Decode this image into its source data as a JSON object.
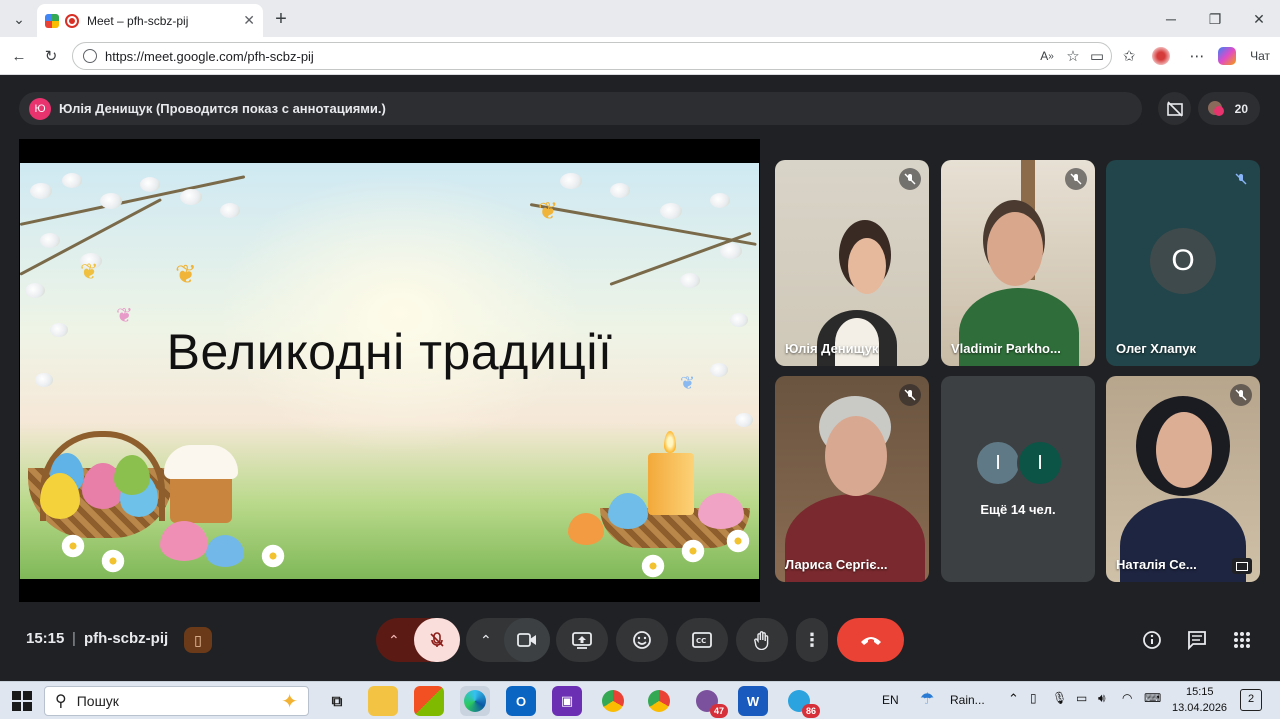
{
  "browser": {
    "tab_title": "Meet – pfh-scbz-pij",
    "url": "https://meet.google.com/pfh-scbz-pij",
    "chat_label": "Чат"
  },
  "meet": {
    "presenter_initial": "Ю",
    "presenter_text": "Юлія Денищук (Проводится показ с аннотациями.)",
    "participant_count": "20",
    "slide_title": "Великодні традиції",
    "tiles": [
      {
        "name": "Юлія Денищук"
      },
      {
        "name": "Vladimir Parkho..."
      },
      {
        "name": "Олег Хлапук",
        "initial": "О"
      },
      {
        "name": "Лариса Сергіє..."
      },
      {
        "name": "Ещё 14 чел.",
        "initials": [
          "I",
          "I"
        ]
      },
      {
        "name": "Наталія Се..."
      }
    ],
    "time": "15:15",
    "separator": "|",
    "meeting_code": "pfh-scbz-pij",
    "colors": {
      "end_call": "#ea4335",
      "mic_off_bg": "#f9dedc",
      "raise_bg": "#5c1a14",
      "accent_pink": "#e8336f"
    }
  },
  "taskbar": {
    "search_placeholder": "Пошук",
    "badges": {
      "viber": "47",
      "telegram": "86"
    },
    "lang": "EN",
    "weather": "Rain...",
    "clock_time": "15:15",
    "clock_date": "13.04.2026",
    "notifications": "2"
  }
}
